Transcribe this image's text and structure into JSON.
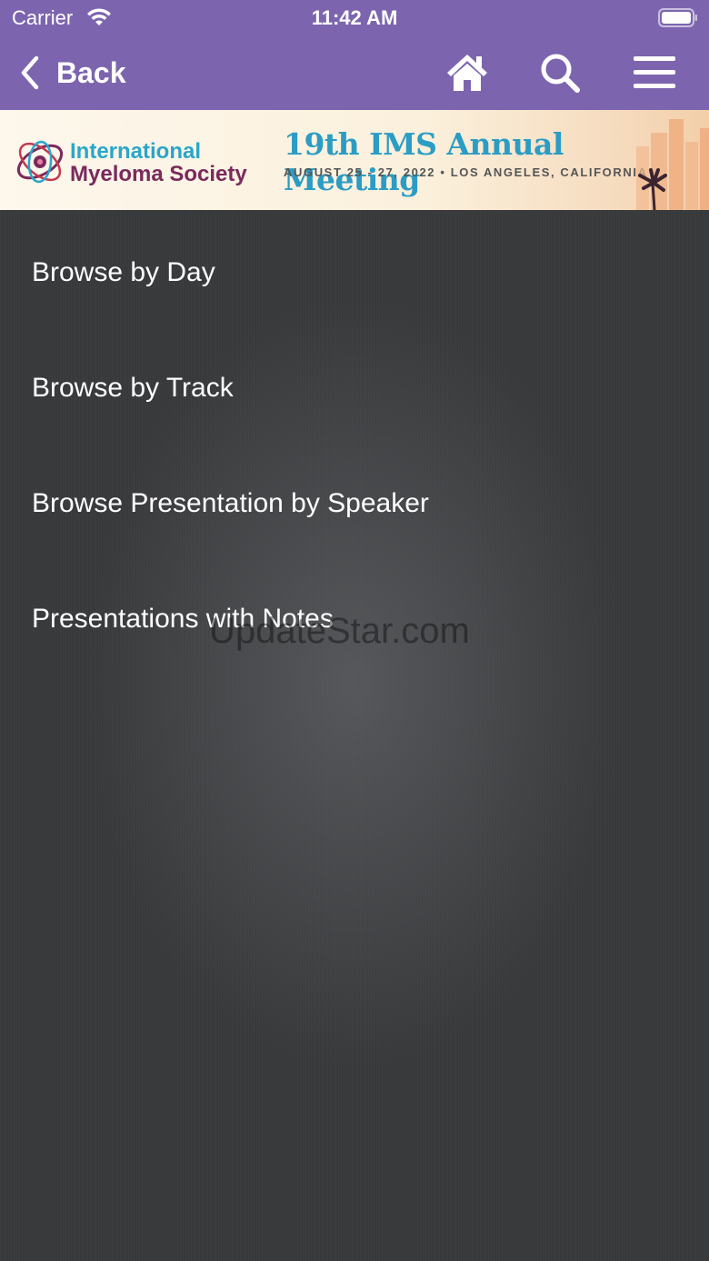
{
  "status_bar": {
    "carrier": "Carrier",
    "time": "11:42 AM",
    "wifi_icon": "wifi-icon",
    "battery_icon": "battery-icon"
  },
  "nav_bar": {
    "back_label": "Back",
    "icons": [
      "chevron-left-icon",
      "home-icon",
      "search-icon",
      "hamburger-menu-icon"
    ],
    "background": "#7c65ae"
  },
  "banner": {
    "logo_line1": "International",
    "logo_line2": "Myeloma Society",
    "title": "19th IMS Annual Meeting",
    "subtitle": "AUGUST 25 - 27, 2022 • LOS ANGELES, CALIFORNIA"
  },
  "menu": {
    "items": [
      {
        "label": "Browse by Day"
      },
      {
        "label": "Browse by Track"
      },
      {
        "label": "Browse Presentation by Speaker"
      },
      {
        "label": "Presentations with Notes"
      }
    ]
  },
  "watermark": "UpdateStar.com"
}
